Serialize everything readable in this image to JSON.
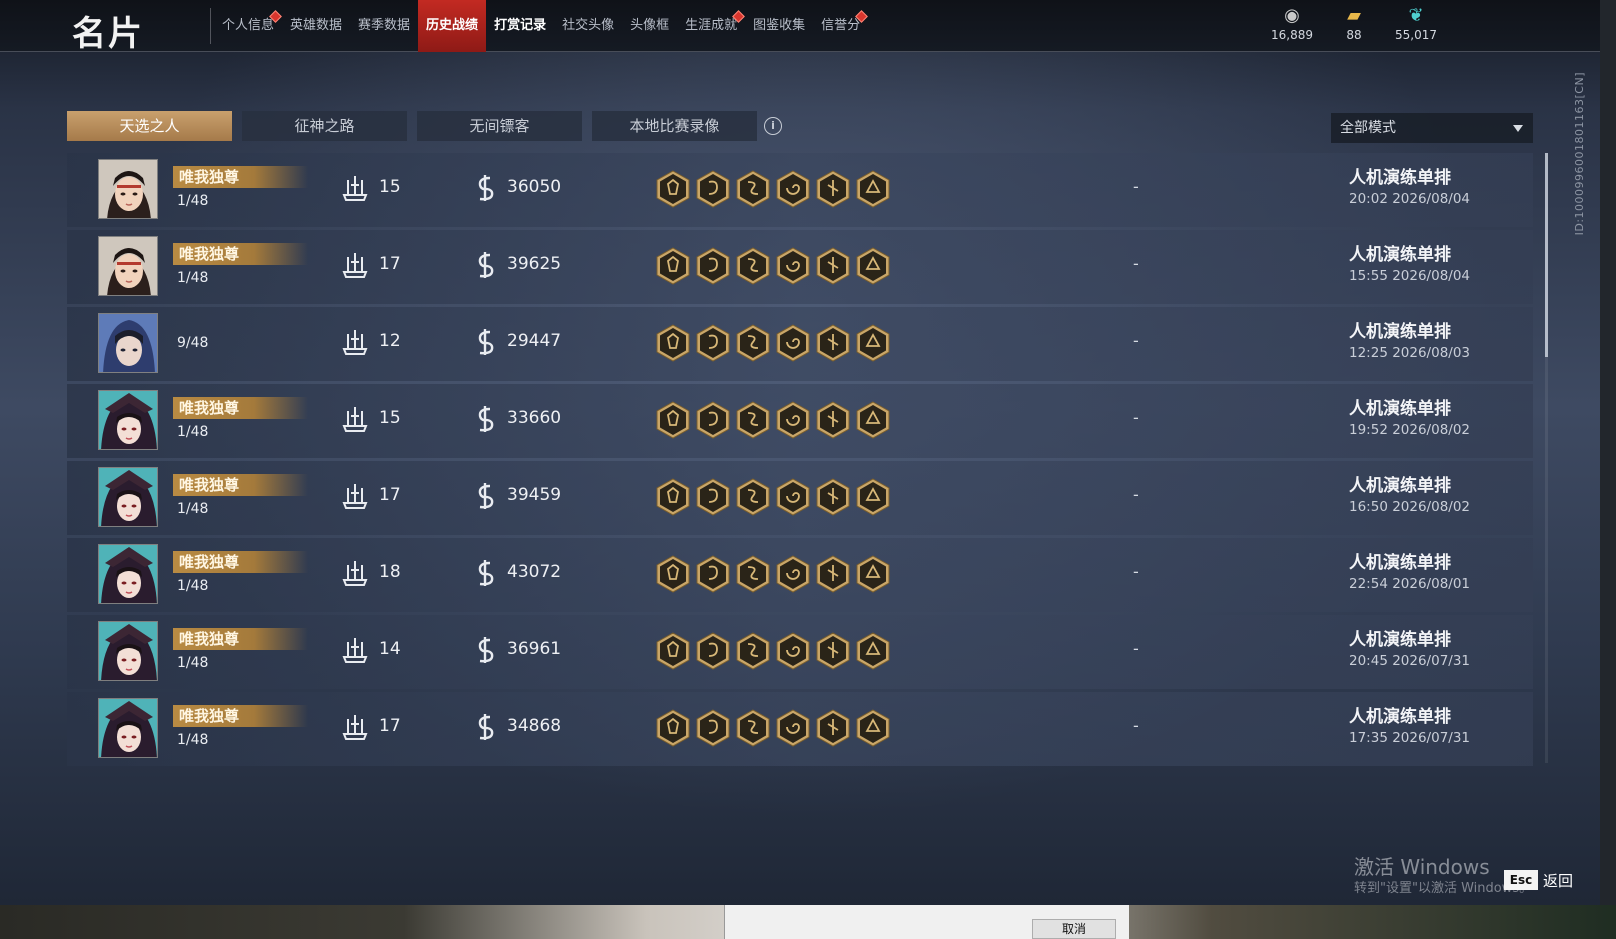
{
  "header": {
    "title": "名片",
    "tabs": [
      {
        "label": "个人信息",
        "badge": true,
        "active": false,
        "bold": false
      },
      {
        "label": "英雄数据",
        "badge": false,
        "active": false,
        "bold": false
      },
      {
        "label": "赛季数据",
        "badge": false,
        "active": false,
        "bold": false
      },
      {
        "label": "历史战绩",
        "badge": false,
        "active": true,
        "bold": true
      },
      {
        "label": "打赏记录",
        "badge": false,
        "active": false,
        "bold": true
      },
      {
        "label": "社交头像",
        "badge": false,
        "active": false,
        "bold": false
      },
      {
        "label": "头像框",
        "badge": false,
        "active": false,
        "bold": false
      },
      {
        "label": "生涯成就",
        "badge": true,
        "active": false,
        "bold": false
      },
      {
        "label": "图鉴收集",
        "badge": false,
        "active": false,
        "bold": false
      },
      {
        "label": "信誉分",
        "badge": true,
        "active": false,
        "bold": false
      }
    ],
    "currencies": [
      {
        "icon": "coin-icon",
        "value": "16,889"
      },
      {
        "icon": "ticket-icon",
        "value": "88"
      },
      {
        "icon": "jade-icon",
        "value": "55,017"
      }
    ]
  },
  "player_id": "ID:1000996001801163[CN]",
  "sub_tabs": [
    {
      "label": "天选之人",
      "active": true
    },
    {
      "label": "征神之路",
      "active": false
    },
    {
      "label": "无间镖客",
      "active": false
    },
    {
      "label": "本地比赛录像",
      "active": false
    }
  ],
  "mode_filter": {
    "value": "全部模式"
  },
  "matches": [
    {
      "avatar": "a",
      "title": "唯我独尊",
      "rank": "1/48",
      "kills": "15",
      "damage": "36050",
      "extra": "-",
      "mode": "人机演练单排",
      "time": "20:02  2026/08/04"
    },
    {
      "avatar": "a",
      "title": "唯我独尊",
      "rank": "1/48",
      "kills": "17",
      "damage": "39625",
      "extra": "-",
      "mode": "人机演练单排",
      "time": "15:55  2026/08/04"
    },
    {
      "avatar": "b",
      "title": "",
      "rank": "9/48",
      "kills": "12",
      "damage": "29447",
      "extra": "-",
      "mode": "人机演练单排",
      "time": "12:25  2026/08/03"
    },
    {
      "avatar": "c",
      "title": "唯我独尊",
      "rank": "1/48",
      "kills": "15",
      "damage": "33660",
      "extra": "-",
      "mode": "人机演练单排",
      "time": "19:52  2026/08/02"
    },
    {
      "avatar": "c",
      "title": "唯我独尊",
      "rank": "1/48",
      "kills": "17",
      "damage": "39459",
      "extra": "-",
      "mode": "人机演练单排",
      "time": "16:50  2026/08/02"
    },
    {
      "avatar": "c",
      "title": "唯我独尊",
      "rank": "1/48",
      "kills": "18",
      "damage": "43072",
      "extra": "-",
      "mode": "人机演练单排",
      "time": "22:54  2026/08/01"
    },
    {
      "avatar": "c",
      "title": "唯我独尊",
      "rank": "1/48",
      "kills": "14",
      "damage": "36961",
      "extra": "-",
      "mode": "人机演练单排",
      "time": "20:45  2026/07/31"
    },
    {
      "avatar": "c",
      "title": "唯我独尊",
      "rank": "1/48",
      "kills": "17",
      "damage": "34868",
      "extra": "-",
      "mode": "人机演练单排",
      "time": "17:35  2026/07/31"
    }
  ],
  "achievement_icons": [
    "oni-mask-icon",
    "swirl-icon",
    "serpent-icon",
    "spiral-blade-icon",
    "sigil-icon",
    "trophy-icon"
  ],
  "footer": {
    "activate_title": "激活 Windows",
    "activate_sub": "转到\"设置\"以激活 Windows。",
    "esc_key": "Esc",
    "back_label": "返回"
  },
  "dialog": {
    "cancel_label": "取消"
  },
  "colors": {
    "accent_red": "#c32a22",
    "gold": "#b98b43",
    "panel": "#2f3a4f"
  }
}
